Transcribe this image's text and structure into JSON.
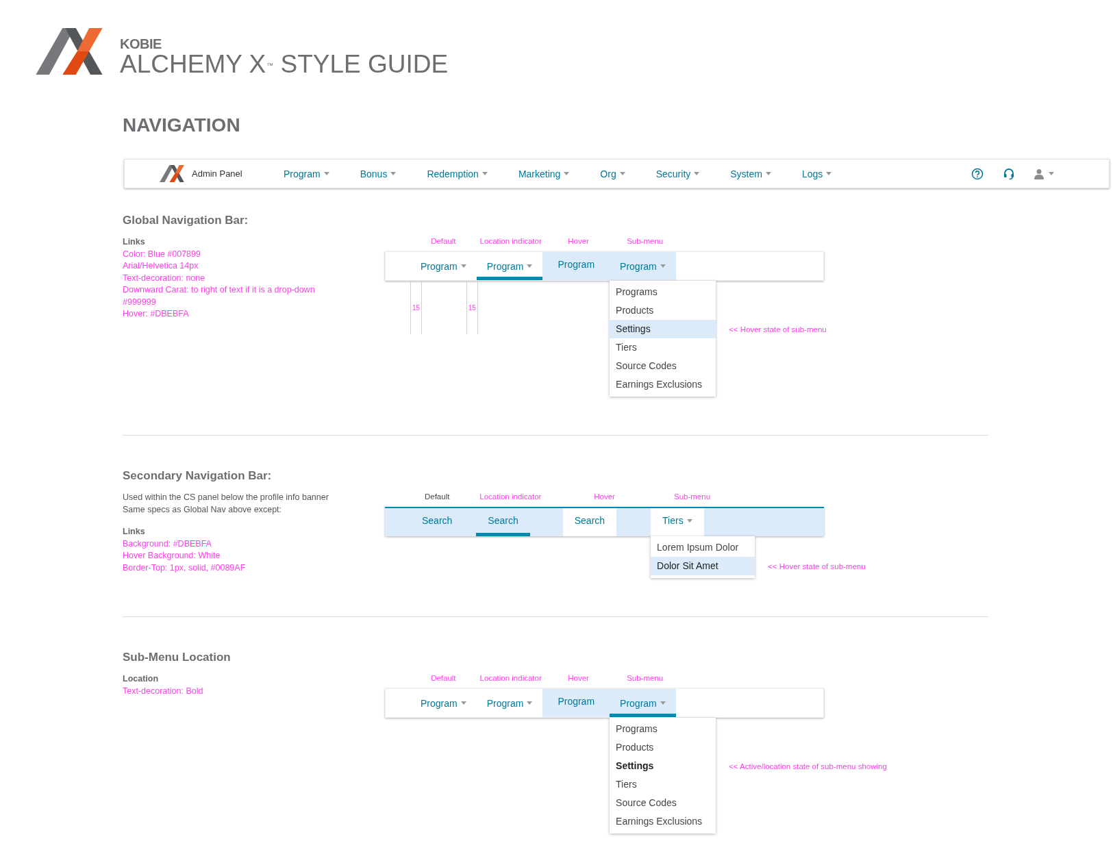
{
  "header": {
    "brand": "KOBIE",
    "title": "ALCHEMY X",
    "trademark": "™",
    "title_suffix": "STYLE GUIDE"
  },
  "page_title": "NAVIGATION",
  "admin_nav": {
    "label": "Admin Panel",
    "items": [
      {
        "label": "Program",
        "dropdown": true
      },
      {
        "label": "Bonus",
        "dropdown": true
      },
      {
        "label": "Redemption",
        "dropdown": true
      },
      {
        "label": "Marketing",
        "dropdown": true
      },
      {
        "label": "Org",
        "dropdown": true
      },
      {
        "label": "Security",
        "dropdown": true
      },
      {
        "label": "System",
        "dropdown": true
      },
      {
        "label": "Logs",
        "dropdown": true
      }
    ]
  },
  "sections": [
    {
      "heading": "Global Navigation Bar:",
      "notes": [
        {
          "kind": "label",
          "text": "Links"
        },
        {
          "kind": "spec",
          "text": "Color: Blue #007899"
        },
        {
          "kind": "spec",
          "text": "Arial/Helvetica 14px"
        },
        {
          "kind": "spec",
          "text": "Text-decoration: none"
        },
        {
          "kind": "spec",
          "text": "Downward Carat: to right of text if it is a drop-down"
        },
        {
          "kind": "spec",
          "text": "#999999"
        },
        {
          "kind": "spec",
          "text": "Hover: #DBEBFA"
        }
      ],
      "state_labels": [
        {
          "kind": "spec",
          "text": "Default"
        },
        {
          "kind": "spec",
          "text": "Location indicator"
        },
        {
          "kind": "spec",
          "text": "Hover"
        },
        {
          "kind": "spec",
          "text": "Sub-menu"
        }
      ],
      "bar": {
        "kind": "primary",
        "items": [
          {
            "label": "Program",
            "dropdown": true,
            "highlighted": false,
            "underline": false
          },
          {
            "label": "Program",
            "dropdown": true,
            "highlighted": false,
            "underline": true
          },
          {
            "label": "Program",
            "dropdown": false,
            "highlighted": true,
            "underline": false
          },
          {
            "label": "Program",
            "dropdown": true,
            "highlighted": true,
            "underline": false
          }
        ]
      },
      "measures": [
        "15",
        "15"
      ],
      "submenu": [
        {
          "label": "Programs",
          "hover": false,
          "current": false
        },
        {
          "label": "Products",
          "hover": false,
          "current": false
        },
        {
          "label": "Settings",
          "hover": true,
          "current": false
        },
        {
          "label": "Tiers",
          "hover": false,
          "current": false
        },
        {
          "label": "Source Codes",
          "hover": false,
          "current": false
        },
        {
          "label": "Earnings Exclusions",
          "hover": false,
          "current": false
        }
      ],
      "annotation": "<< Hover state of sub-menu"
    },
    {
      "heading": "Secondary Navigation Bar:",
      "notes": [
        {
          "kind": "text",
          "text": "Used within the CS panel below the profile info banner"
        },
        {
          "kind": "text",
          "text": "Same specs as Global Nav above except:"
        },
        {
          "kind": "label",
          "text": "Links"
        },
        {
          "kind": "spec",
          "text": "Background: #DBEBFA"
        },
        {
          "kind": "spec",
          "text": "Hover Background: White"
        },
        {
          "kind": "spec",
          "text": "Border-Top: 1px, solid, #0089AF"
        }
      ],
      "state_labels": [
        {
          "kind": "text",
          "text": "Default"
        },
        {
          "kind": "spec",
          "text": "Location indicator"
        },
        {
          "kind": "spec",
          "text": "Hover"
        },
        {
          "kind": "spec",
          "text": "Sub-menu"
        }
      ],
      "bar": {
        "kind": "secondary",
        "items": [
          {
            "label": "Search",
            "dropdown": false,
            "highlighted": false,
            "underline": false
          },
          {
            "label": "Search",
            "dropdown": false,
            "highlighted": false,
            "underline": true
          },
          {
            "label": "Search",
            "dropdown": false,
            "highlighted": true,
            "underline": false
          },
          {
            "label": "Tiers",
            "dropdown": true,
            "highlighted": true,
            "underline": false
          }
        ]
      },
      "submenu": [
        {
          "label": "Lorem Ipsum Dolor",
          "hover": false,
          "current": false
        },
        {
          "label": "Dolor Sit Amet",
          "hover": true,
          "current": false
        }
      ],
      "annotation": "<< Hover state of sub-menu"
    },
    {
      "heading": "Sub-Menu Location",
      "notes": [
        {
          "kind": "label",
          "text": "Location"
        },
        {
          "kind": "spec",
          "text": "Text-decoration: Bold"
        }
      ],
      "state_labels": [
        {
          "kind": "spec",
          "text": "Default"
        },
        {
          "kind": "spec",
          "text": "Location indicator"
        },
        {
          "kind": "spec",
          "text": "Hover"
        },
        {
          "kind": "spec",
          "text": "Sub-menu"
        }
      ],
      "bar": {
        "kind": "primary",
        "items": [
          {
            "label": "Program",
            "dropdown": true,
            "highlighted": false,
            "underline": false
          },
          {
            "label": "Program",
            "dropdown": true,
            "highlighted": false,
            "underline": false
          },
          {
            "label": "Program",
            "dropdown": false,
            "highlighted": true,
            "underline": false
          },
          {
            "label": "Program",
            "dropdown": true,
            "highlighted": true,
            "underline": true
          }
        ]
      },
      "submenu": [
        {
          "label": "Programs",
          "hover": false,
          "current": false
        },
        {
          "label": "Products",
          "hover": false,
          "current": false
        },
        {
          "label": "Settings",
          "hover": false,
          "current": true
        },
        {
          "label": "Tiers",
          "hover": false,
          "current": false
        },
        {
          "label": "Source Codes",
          "hover": false,
          "current": false
        },
        {
          "label": "Earnings Exclusions",
          "hover": false,
          "current": false
        }
      ],
      "annotation": "<< Active/location state of sub-menu showing"
    }
  ]
}
